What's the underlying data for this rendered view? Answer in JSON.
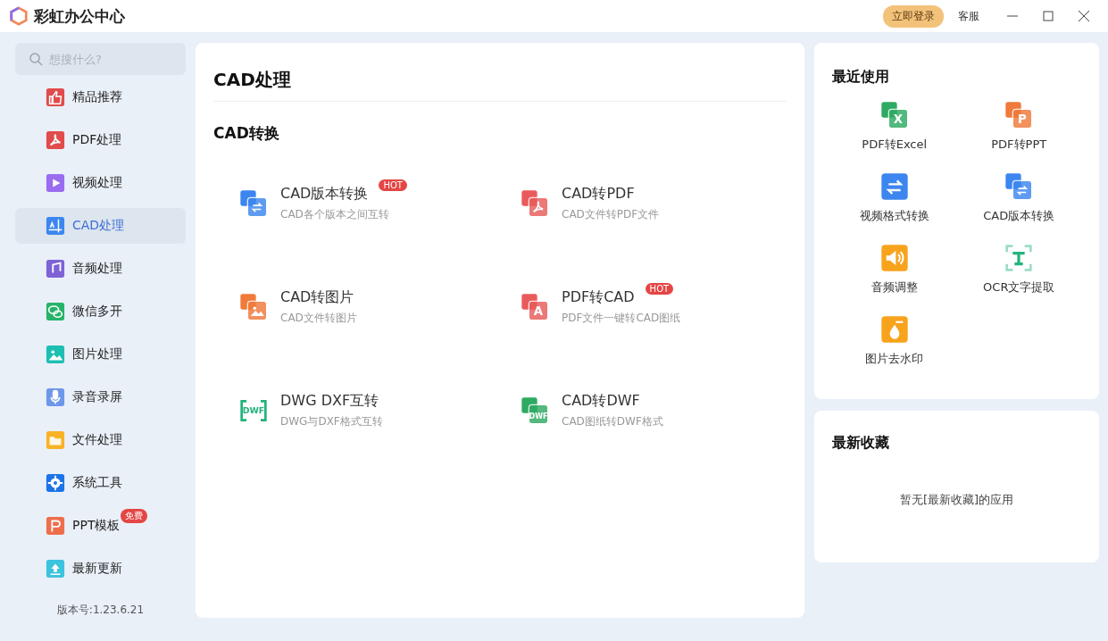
{
  "app": {
    "title": "彩虹办公中心",
    "login": "立即登录",
    "support": "客服"
  },
  "search": {
    "placeholder": "想搜什么?"
  },
  "sidebar": {
    "items": [
      {
        "label": "精品推荐",
        "kind": "thumb",
        "color": "#e14b4b",
        "selected": false
      },
      {
        "label": "PDF处理",
        "kind": "pdf",
        "color": "#e14b4b",
        "selected": false
      },
      {
        "label": "视频处理",
        "kind": "play",
        "color": "#9a6cf0",
        "selected": false
      },
      {
        "label": "CAD处理",
        "kind": "cad",
        "color": "#3d86ef",
        "selected": true
      },
      {
        "label": "音频处理",
        "kind": "music",
        "color": "#7e62d6",
        "selected": false
      },
      {
        "label": "微信多开",
        "kind": "chat",
        "color": "#27b36a",
        "selected": false
      },
      {
        "label": "图片处理",
        "kind": "image",
        "color": "#1dbfb2",
        "selected": false
      },
      {
        "label": "录音录屏",
        "kind": "mic",
        "color": "#6d98ea",
        "selected": false
      },
      {
        "label": "文件处理",
        "kind": "folder",
        "color": "#f8b325",
        "selected": false
      },
      {
        "label": "系统工具",
        "kind": "gear",
        "color": "#1b74e8",
        "selected": false
      },
      {
        "label": "PPT模板",
        "kind": "ppt",
        "color": "#ee6e4c",
        "selected": false,
        "badge": "免费"
      },
      {
        "label": "最新更新",
        "kind": "upload",
        "color": "#3cc3de",
        "selected": false
      }
    ],
    "version": "版本号:1.23.6.21"
  },
  "main": {
    "title": "CAD处理",
    "section": "CAD转换",
    "tools": [
      {
        "title": "CAD版本转换",
        "subtitle": "CAD各个版本之间互转",
        "kind": "swap",
        "color": "#3d86ef",
        "badge": "HOT"
      },
      {
        "title": "CAD转PDF",
        "subtitle": "CAD文件转PDF文件",
        "kind": "pdf",
        "color": "#e95b5b"
      },
      {
        "title": "CAD转图片",
        "subtitle": "CAD文件转图片",
        "kind": "image",
        "color": "#f07a3a"
      },
      {
        "title": "PDF转CAD",
        "subtitle": "PDF文件一键转CAD图纸",
        "kind": "letter",
        "icon_text": "A",
        "color": "#e95b5b",
        "badge": "HOT"
      },
      {
        "title": "DWG DXF互转",
        "subtitle": "DWG与DXF格式互转",
        "kind": "cycle",
        "icon_text": "DWF",
        "color": "#21b27a"
      },
      {
        "title": "CAD转DWF",
        "subtitle": "CAD图纸转DWF格式",
        "kind": "letter",
        "icon_text": "DWF",
        "color": "#2eaa62"
      }
    ]
  },
  "recent": {
    "title": "最近使用",
    "items": [
      {
        "label": "PDF转Excel",
        "kind": "letter",
        "icon_text": "X",
        "color": "#2eaa62"
      },
      {
        "label": "PDF转PPT",
        "kind": "letter",
        "icon_text": "P",
        "color": "#f07a3a"
      },
      {
        "label": "视频格式转换",
        "kind": "swap1",
        "color": "#3d86ef"
      },
      {
        "label": "CAD版本转换",
        "kind": "swap",
        "color": "#3d86ef"
      },
      {
        "label": "音频调整",
        "kind": "speaker",
        "color": "#f8a31c"
      },
      {
        "label": "OCR文字提取",
        "kind": "ocr",
        "color": "#22b47c"
      },
      {
        "label": "图片去水印",
        "kind": "drop",
        "color": "#f8a31c"
      }
    ]
  },
  "favorites": {
    "title": "最新收藏",
    "empty": "暂无[最新收藏]的应用"
  }
}
